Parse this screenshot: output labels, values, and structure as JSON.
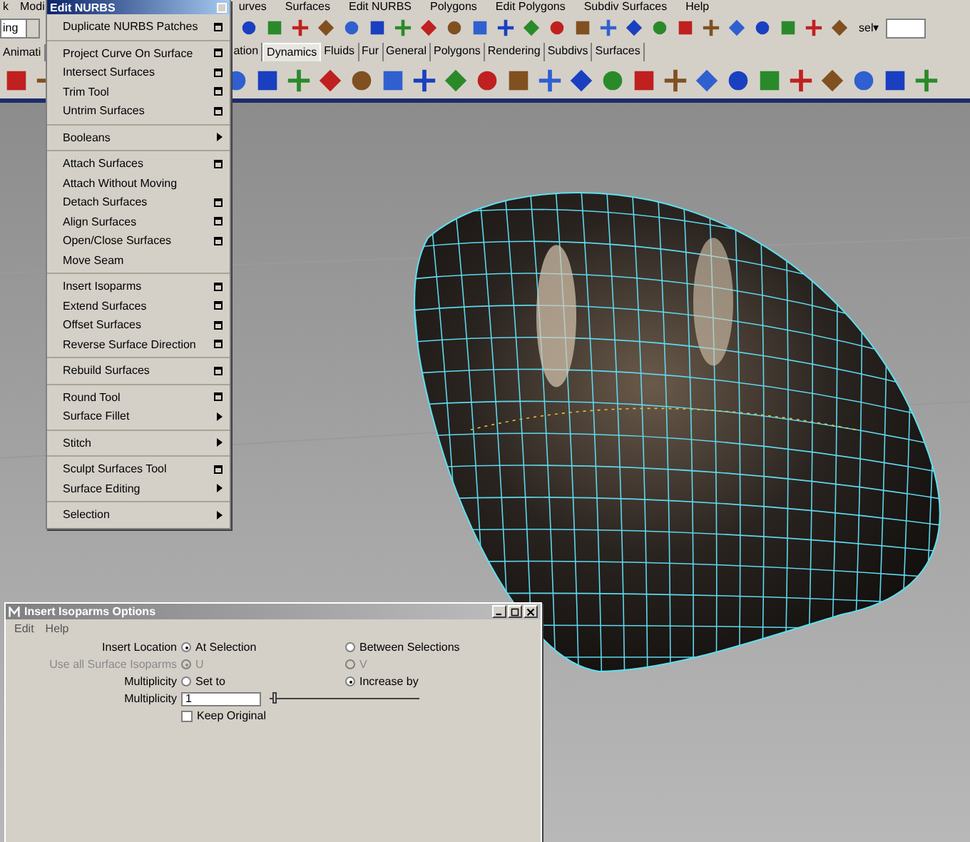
{
  "menu_bar": {
    "left_items": [
      "k",
      "Modi"
    ],
    "right_items": [
      "urves",
      "Surfaces",
      "Edit NURBS",
      "Polygons",
      "Edit Polygons",
      "Subdiv Surfaces",
      "Help"
    ]
  },
  "status_line": {
    "mode_dropdown": "ing",
    "selection_label": "sel▾"
  },
  "shelf_tabs": {
    "left": [
      {
        "label": "Animati",
        "selected": false
      }
    ],
    "right": [
      {
        "label": "ation",
        "selected": false
      },
      {
        "label": "Dynamics",
        "selected": true
      },
      {
        "label": "Fluids",
        "selected": false
      },
      {
        "label": "Fur",
        "selected": false
      },
      {
        "label": "General",
        "selected": false
      },
      {
        "label": "Polygons",
        "selected": false
      },
      {
        "label": "Rendering",
        "selected": false
      },
      {
        "label": "Subdivs",
        "selected": false
      },
      {
        "label": "Surfaces",
        "selected": false
      }
    ]
  },
  "edit_nurbs_menu": {
    "title": "Edit NURBS",
    "sections": [
      [
        {
          "label": "Duplicate NURBS Patches",
          "kind": "option"
        }
      ],
      [
        {
          "label": "Project Curve On Surface",
          "kind": "option"
        },
        {
          "label": "Intersect Surfaces",
          "kind": "option"
        },
        {
          "label": "Trim Tool",
          "kind": "option"
        },
        {
          "label": "Untrim Surfaces",
          "kind": "option"
        }
      ],
      [
        {
          "label": "Booleans",
          "kind": "submenu"
        }
      ],
      [
        {
          "label": "Attach Surfaces",
          "kind": "option"
        },
        {
          "label": "Attach Without Moving",
          "kind": "plain"
        },
        {
          "label": "Detach Surfaces",
          "kind": "option"
        },
        {
          "label": "Align Surfaces",
          "kind": "option"
        },
        {
          "label": "Open/Close Surfaces",
          "kind": "option"
        },
        {
          "label": "Move Seam",
          "kind": "plain"
        }
      ],
      [
        {
          "label": "Insert Isoparms",
          "kind": "option"
        },
        {
          "label": "Extend Surfaces",
          "kind": "option"
        },
        {
          "label": "Offset Surfaces",
          "kind": "option"
        },
        {
          "label": "Reverse Surface Direction",
          "kind": "option"
        }
      ],
      [
        {
          "label": "Rebuild Surfaces",
          "kind": "option"
        }
      ],
      [
        {
          "label": "Round Tool",
          "kind": "option"
        },
        {
          "label": "Surface Fillet",
          "kind": "submenu"
        }
      ],
      [
        {
          "label": "Stitch",
          "kind": "submenu"
        }
      ],
      [
        {
          "label": "Sculpt Surfaces Tool",
          "kind": "option"
        },
        {
          "label": "Surface Editing",
          "kind": "submenu"
        }
      ],
      [
        {
          "label": "Selection",
          "kind": "submenu"
        }
      ]
    ]
  },
  "options_dialog": {
    "title": "Insert Isoparms Options",
    "menu": [
      "Edit",
      "Help"
    ],
    "rows": [
      {
        "label": "Insert Location",
        "disabled": false,
        "options": [
          {
            "label": "At Selection",
            "selected": true
          },
          {
            "label": "Between Selections",
            "selected": false
          }
        ]
      },
      {
        "label": "Use all Surface Isoparms",
        "disabled": true,
        "options": [
          {
            "label": "U",
            "selected": true
          },
          {
            "label": "V",
            "selected": false
          }
        ]
      },
      {
        "label": "Multiplicity",
        "disabled": false,
        "options": [
          {
            "label": "Set to",
            "selected": false
          },
          {
            "label": "Increase by",
            "selected": true
          }
        ]
      }
    ],
    "multiplicity_field": {
      "label": "Multiplicity",
      "value": "1",
      "level": 0.02
    },
    "keep_original": {
      "label": "Keep Original",
      "checked": false
    }
  }
}
